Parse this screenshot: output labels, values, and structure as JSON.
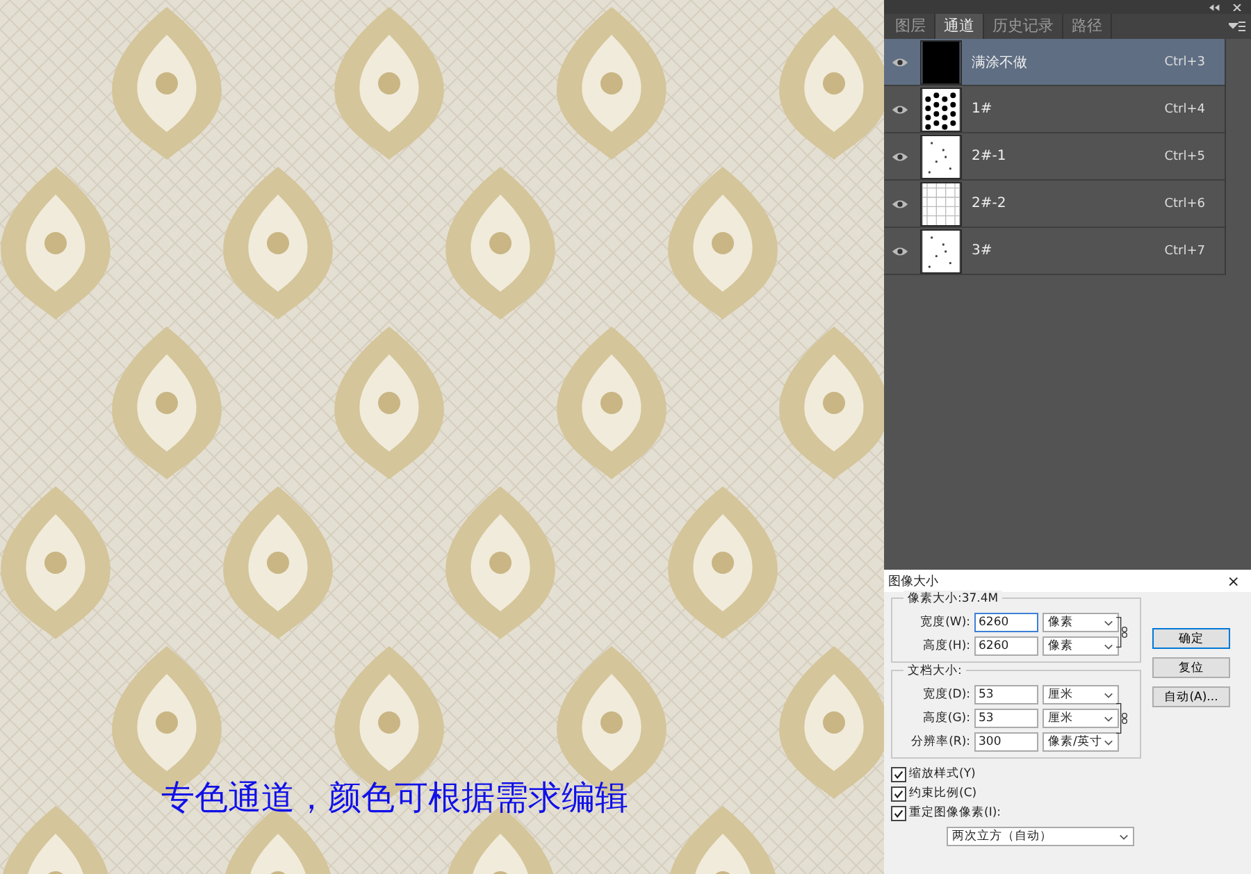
{
  "canvas": {
    "caption": "专色通道，颜色可根据需求编辑"
  },
  "channels_panel": {
    "tabs": [
      {
        "label": "图层",
        "selected": false
      },
      {
        "label": "通道",
        "selected": true
      },
      {
        "label": "历史记录",
        "selected": false
      },
      {
        "label": "路径",
        "selected": false
      }
    ],
    "rows": [
      {
        "name": "满涂不做",
        "shortcut": "Ctrl+3",
        "visible": true,
        "selected": true,
        "kind": "solid"
      },
      {
        "name": "1#",
        "shortcut": "Ctrl+4",
        "visible": true,
        "selected": false,
        "kind": "dense"
      },
      {
        "name": "2#-1",
        "shortcut": "Ctrl+5",
        "visible": true,
        "selected": false,
        "kind": "sparse"
      },
      {
        "name": "2#-2",
        "shortcut": "Ctrl+6",
        "visible": true,
        "selected": false,
        "kind": "grid"
      },
      {
        "name": "3#",
        "shortcut": "Ctrl+7",
        "visible": true,
        "selected": false,
        "kind": "sparse"
      }
    ]
  },
  "image_size_dialog": {
    "title": "图像大小",
    "close": "×",
    "pixel_group": {
      "legend": "像素大小:37.4M",
      "fields": [
        {
          "label": "宽度(W):",
          "value": "6260",
          "unit": "像素"
        },
        {
          "label": "高度(H):",
          "value": "6260",
          "unit": "像素"
        }
      ]
    },
    "document_group": {
      "legend": "文档大小:",
      "fields": [
        {
          "label": "宽度(D):",
          "value": "53",
          "unit": "厘米"
        },
        {
          "label": "高度(G):",
          "value": "53",
          "unit": "厘米"
        },
        {
          "label": "分辨率(R):",
          "value": "300",
          "unit": "像素/英寸"
        }
      ]
    },
    "checkboxes": [
      {
        "label": "缩放样式(Y)",
        "checked": true
      },
      {
        "label": "约束比例(C)",
        "checked": true
      },
      {
        "label": "重定图像像素(I):",
        "checked": true
      }
    ],
    "resample": "两次立方（自动）",
    "buttons": [
      {
        "label": "确定",
        "selected": true
      },
      {
        "label": "复位",
        "selected": false
      },
      {
        "label": "自动(A)...",
        "selected": false
      }
    ]
  }
}
